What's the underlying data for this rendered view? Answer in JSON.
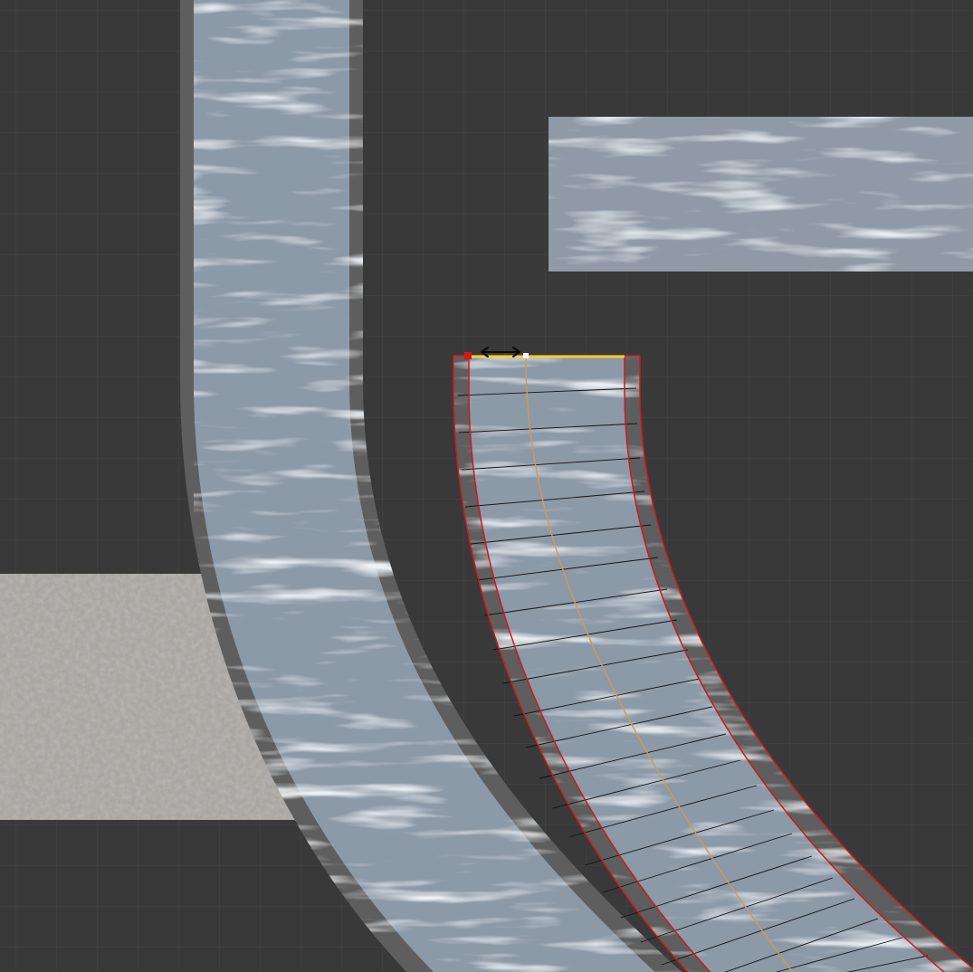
{
  "viewport": {
    "background": "#393939",
    "grid_color": "#444444"
  },
  "materials": {
    "ice_road": "#8b98a6",
    "road_edge": "#5c5c5c",
    "concrete_slab": "#a8a6a2",
    "ice_slab": "#8e99a5"
  },
  "selection": {
    "outline_color": "#cc1a1a",
    "handle_color": "#f2d035",
    "centerline_color": "#d29a54",
    "slice_line_color": "#111111",
    "point_color": "#ffffff",
    "arrow_icon": "double-arrow-icon"
  }
}
